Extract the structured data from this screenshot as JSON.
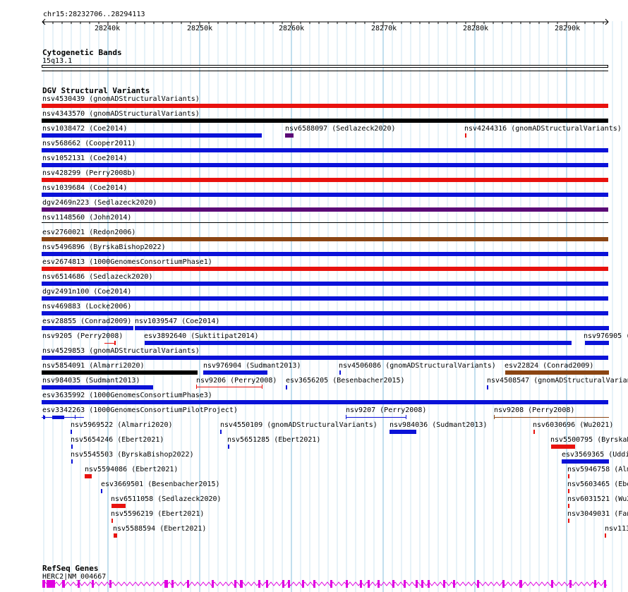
{
  "header": {
    "region": "chr15:28232706..28294113",
    "ticks": [
      "28240k",
      "28250k",
      "28260k",
      "28270k",
      "28280k",
      "28290k"
    ]
  },
  "cytoband": {
    "title": "Cytogenetic Bands",
    "band": "15q13.1"
  },
  "dgv": {
    "title": "DGV Structural Variants",
    "colors": {
      "red": "#e8120e",
      "blue": "#0b12d8",
      "black": "#000000",
      "purple": "#5a0a76",
      "brown": "#8b4513"
    },
    "features": [
      {
        "label": "nsv4530439 (gnomADStructuralVariants)",
        "color": "red"
      },
      {
        "label": "nsv4343570 (gnomADStructuralVariants)",
        "color": "black"
      },
      {
        "label": "nsv1038472 (Coe2014)",
        "color": "blue"
      },
      {
        "label": "nsv6588097 (Sedlazeck2020)",
        "color": "purple"
      },
      {
        "label": "nsv4244316 (gnomADStructuralVariants)",
        "color": "red"
      },
      {
        "label": "nsv568662 (Cooper2011)",
        "color": "blue"
      },
      {
        "label": "nsv1052131 (Coe2014)",
        "color": "blue"
      },
      {
        "label": "nsv428299 (Perry2008b)",
        "color": "red"
      },
      {
        "label": "nsv1039684 (Coe2014)",
        "color": "blue"
      },
      {
        "label": "dgv2469n223 (Sedlazeck2020)",
        "color": "purple"
      },
      {
        "label": "nsv1148560 (John2014)",
        "color": "black"
      },
      {
        "label": "esv2760021 (Redon2006)",
        "color": "brown"
      },
      {
        "label": "nsv5496896 (ByrskaBishop2022)",
        "color": "blue"
      },
      {
        "label": "esv2674813 (1000GenomesConsortiumPhase1)",
        "color": "red"
      },
      {
        "label": "nsv6514686 (Sedlazeck2020)",
        "color": "blue"
      },
      {
        "label": "dgv2491n100 (Coe2014)",
        "color": "blue"
      },
      {
        "label": "nsv469883 (Locke2006)",
        "color": "blue"
      },
      {
        "label": "esv28855 (Conrad2009)",
        "color": "blue"
      },
      {
        "label": "nsv1039547 (Coe2014)",
        "color": "blue"
      },
      {
        "label": "nsv9205 (Perry2008)",
        "color": "red"
      },
      {
        "label": "esv3892640 (Suktitipat2014)",
        "color": "blue"
      },
      {
        "label": "nsv976905 (",
        "color": "blue"
      },
      {
        "label": "nsv4529853 (gnomADStructuralVariants)",
        "color": "blue"
      },
      {
        "label": "nsv5854091 (Almarri2020)",
        "color": "black"
      },
      {
        "label": "nsv976904 (Sudmant2013)",
        "color": "blue"
      },
      {
        "label": "nsv4506086 (gnomADStructuralVariants)",
        "color": "blue"
      },
      {
        "label": "esv22824 (Conrad2009)",
        "color": "brown"
      },
      {
        "label": "nsv984035 (Sudmant2013)",
        "color": "blue"
      },
      {
        "label": "nsv9206 (Perry2008)",
        "color": "red"
      },
      {
        "label": "esv3656205 (Besenbacher2015)",
        "color": "blue"
      },
      {
        "label": "nsv4508547 (gnomADStructuralVariants)",
        "color": "blue"
      },
      {
        "label": "esv3635992 (1000GenomesConsortiumPhase3)",
        "color": "blue"
      },
      {
        "label": "esv3342263 (1000GenomesConsortiumPilotProject)",
        "color": "blue"
      },
      {
        "label": "nsv9207 (Perry2008)",
        "color": "blue"
      },
      {
        "label": "nsv9208 (Perry2008)",
        "color": "brown"
      },
      {
        "label": "nsv5969522 (Almarri2020)",
        "color": "blue"
      },
      {
        "label": "nsv4550109 (gnomADStructuralVariants)",
        "color": "blue"
      },
      {
        "label": "nsv984036 (Sudmant2013)",
        "color": "blue"
      },
      {
        "label": "nsv6030696 (Wu2021)",
        "color": "red"
      },
      {
        "label": "nsv5654246 (Ebert2021)",
        "color": "blue"
      },
      {
        "label": "nsv5651285 (Ebert2021)",
        "color": "blue"
      },
      {
        "label": "nsv5500795 (ByrskaB",
        "color": "red"
      },
      {
        "label": "nsv5545503 (ByrskaBishop2022)",
        "color": "blue"
      },
      {
        "label": "esv3569365 (Uddin",
        "color": "blue"
      },
      {
        "label": "nsv5594086 (Ebert2021)",
        "color": "red"
      },
      {
        "label": "nsv5946758 (Alm",
        "color": "red"
      },
      {
        "label": "esv3669501 (Besenbacher2015)",
        "color": "blue"
      },
      {
        "label": "nsv5603465 (Ebe",
        "color": "red"
      },
      {
        "label": "nsv6511058 (Sedlazeck2020)",
        "color": "red"
      },
      {
        "label": "nsv6031521 (Wu2",
        "color": "red"
      },
      {
        "label": "nsv5596219 (Ebert2021)",
        "color": "red"
      },
      {
        "label": "nsv3049031 (Fan",
        "color": "red"
      },
      {
        "label": "nsv5588594 (Ebert2021)",
        "color": "red"
      },
      {
        "label": "nsv113",
        "color": "red"
      }
    ]
  },
  "refseq": {
    "title": "RefSeq Genes",
    "gene": "HERC2|NM_004667",
    "color": "#e000e0"
  }
}
